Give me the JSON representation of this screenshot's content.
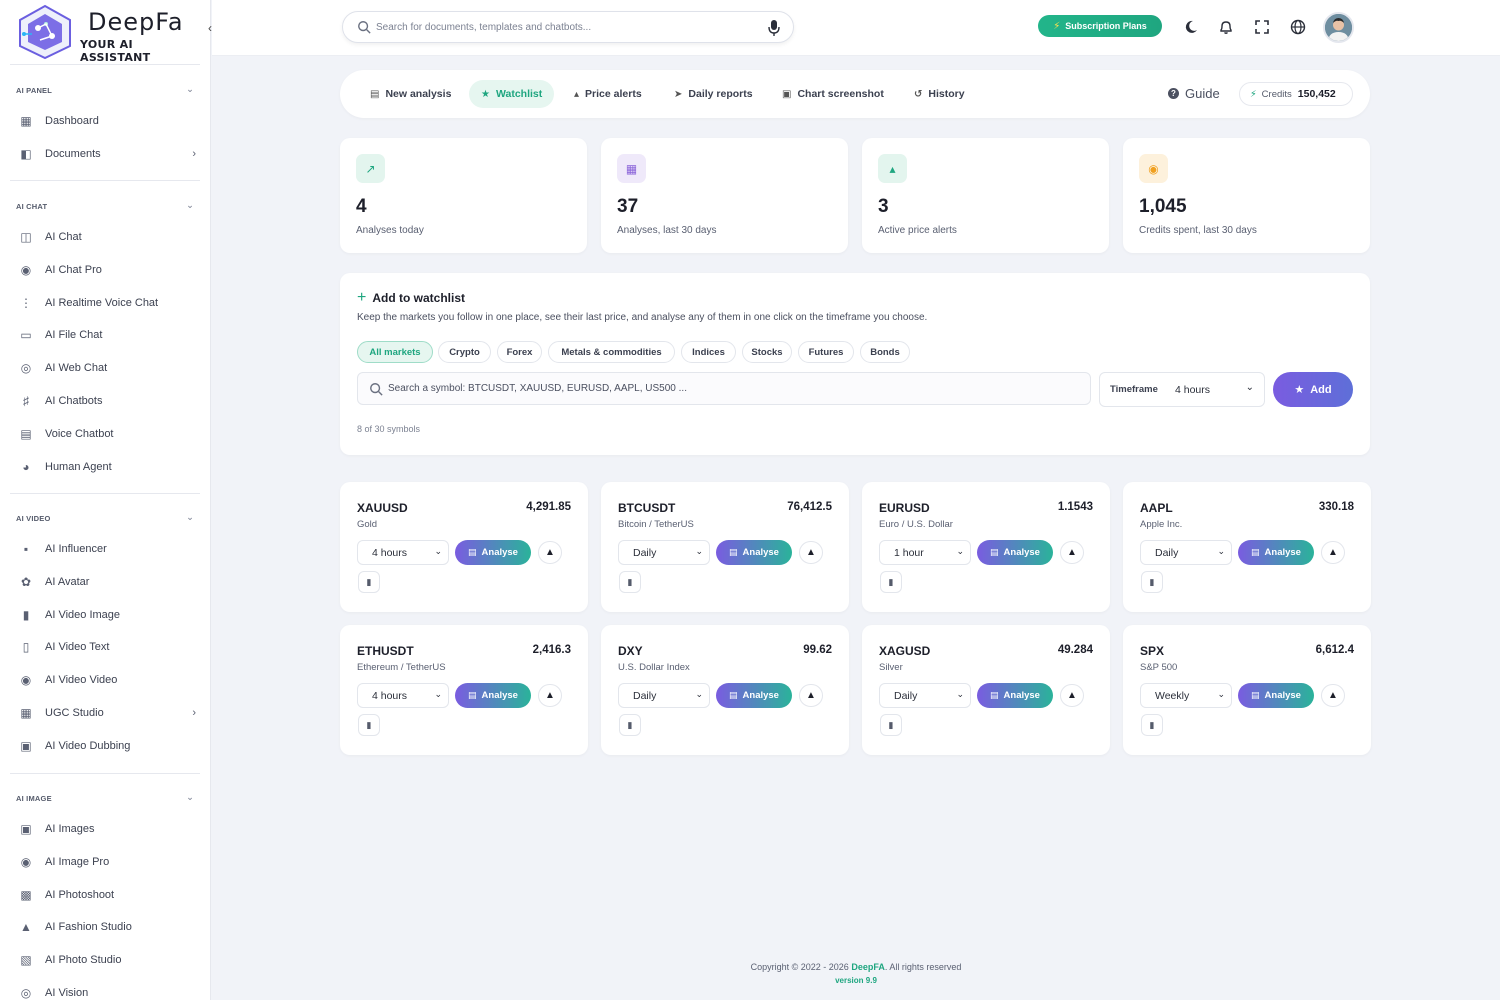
{
  "brand": {
    "name": "DeepFa",
    "tagline": "YOUR AI ASSISTANT"
  },
  "colors": {
    "accent": "#1fa680",
    "primary": "#6b5fe0",
    "background": "#f1f3f8"
  },
  "sidebar": {
    "sections": [
      {
        "title": "AI PANEL",
        "items": [
          {
            "label": "Dashboard",
            "icon": "dashboard-icon"
          },
          {
            "label": "Documents",
            "icon": "document-icon",
            "has_submenu": true
          }
        ]
      },
      {
        "title": "AI CHAT",
        "items": [
          {
            "label": "AI Chat",
            "icon": "chat-icon"
          },
          {
            "label": "AI Chat Pro",
            "icon": "chat-pro-icon"
          },
          {
            "label": "AI Realtime Voice Chat",
            "icon": "waveform-icon"
          },
          {
            "label": "AI File Chat",
            "icon": "folder-icon"
          },
          {
            "label": "AI Web Chat",
            "icon": "globe-icon"
          },
          {
            "label": "AI Chatbots",
            "icon": "robot-icon"
          },
          {
            "label": "Voice Chatbot",
            "icon": "voice-bot-icon"
          },
          {
            "label": "Human Agent",
            "icon": "headset-icon"
          }
        ]
      },
      {
        "title": "AI VIDEO",
        "items": [
          {
            "label": "AI Influencer",
            "icon": "video-camera-icon"
          },
          {
            "label": "AI Avatar",
            "icon": "avatar-icon"
          },
          {
            "label": "AI Video Image",
            "icon": "video-image-icon"
          },
          {
            "label": "AI Video Text",
            "icon": "video-text-icon"
          },
          {
            "label": "AI Video Video",
            "icon": "video-video-icon"
          },
          {
            "label": "UGC Studio",
            "icon": "ugc-icon",
            "has_submenu": true
          },
          {
            "label": "AI Video Dubbing",
            "icon": "dubbing-icon"
          }
        ]
      },
      {
        "title": "AI IMAGE",
        "items": [
          {
            "label": "AI Images",
            "icon": "image-scan-icon"
          },
          {
            "label": "AI Image Pro",
            "icon": "image-pro-icon"
          },
          {
            "label": "AI Photoshoot",
            "icon": "photoshoot-icon"
          },
          {
            "label": "AI Fashion Studio",
            "icon": "tshirt-icon"
          },
          {
            "label": "AI Photo Studio",
            "icon": "photo-studio-icon"
          },
          {
            "label": "AI Vision",
            "icon": "vision-icon"
          }
        ]
      }
    ]
  },
  "topbar": {
    "search_placeholder": "Search for documents, templates and chatbots...",
    "subscription_label": "Subscription Plans"
  },
  "tabs": [
    {
      "label": "New analysis",
      "icon": "chart-line-icon"
    },
    {
      "label": "Watchlist",
      "icon": "star-icon",
      "active": true
    },
    {
      "label": "Price alerts",
      "icon": "bell-icon"
    },
    {
      "label": "Daily reports",
      "icon": "paper-plane-icon"
    },
    {
      "label": "Chart screenshot",
      "icon": "image-icon"
    },
    {
      "label": "History",
      "icon": "history-icon"
    }
  ],
  "guide_label": "Guide",
  "credits": {
    "label": "Credits",
    "value": "150,452"
  },
  "stats": [
    {
      "value": "4",
      "label": "Analyses today",
      "icon": "chart-icon",
      "color": "#1fa680",
      "bg": "#e3f5ee"
    },
    {
      "value": "37",
      "label": "Analyses, last 30 days",
      "icon": "calendar-icon",
      "color": "#8a63d9",
      "bg": "#efe9fa"
    },
    {
      "value": "3",
      "label": "Active price alerts",
      "icon": "bell-icon",
      "color": "#1fa680",
      "bg": "#e3f5ee"
    },
    {
      "value": "1,045",
      "label": "Credits spent, last 30 days",
      "icon": "coins-icon",
      "color": "#f0a020",
      "bg": "#fdf1dc"
    }
  ],
  "add_watchlist": {
    "title": "Add to watchlist",
    "description": "Keep the markets you follow in one place, see their last price, and analyse any of them in one click on the timeframe you choose.",
    "chips": [
      "All markets",
      "Crypto",
      "Forex",
      "Metals & commodities",
      "Indices",
      "Stocks",
      "Futures",
      "Bonds"
    ],
    "active_chip": 0,
    "search_placeholder": "Search a symbol: BTCUSDT, XAUUSD, EURUSD, AAPL, US500 ...",
    "timeframe_label": "Timeframe",
    "timeframe_value": "4 hours",
    "add_label": "Add",
    "count_text": "8 of 30 symbols"
  },
  "watchlist": [
    {
      "symbol": "XAUUSD",
      "name": "Gold",
      "price": "4,291.85",
      "timeframe": "4 hours"
    },
    {
      "symbol": "BTCUSDT",
      "name": "Bitcoin / TetherUS",
      "price": "76,412.5",
      "timeframe": "Daily"
    },
    {
      "symbol": "EURUSD",
      "name": "Euro / U.S. Dollar",
      "price": "1.1543",
      "timeframe": "1 hour"
    },
    {
      "symbol": "AAPL",
      "name": "Apple Inc.",
      "price": "330.18",
      "timeframe": "Daily"
    },
    {
      "symbol": "ETHUSDT",
      "name": "Ethereum / TetherUS",
      "price": "2,416.3",
      "timeframe": "4 hours"
    },
    {
      "symbol": "DXY",
      "name": "U.S. Dollar Index",
      "price": "99.62",
      "timeframe": "Daily"
    },
    {
      "symbol": "XAGUSD",
      "name": "Silver",
      "price": "49.284",
      "timeframe": "Daily"
    },
    {
      "symbol": "SPX",
      "name": "S&P 500",
      "price": "6,612.4",
      "timeframe": "Weekly"
    }
  ],
  "analyse_label": "Analyse",
  "footer": {
    "prefix": "Copyright © 2022 - 2026 ",
    "brand": "DeepFA",
    "suffix": ". All rights reserved",
    "version": "version 9.9"
  }
}
